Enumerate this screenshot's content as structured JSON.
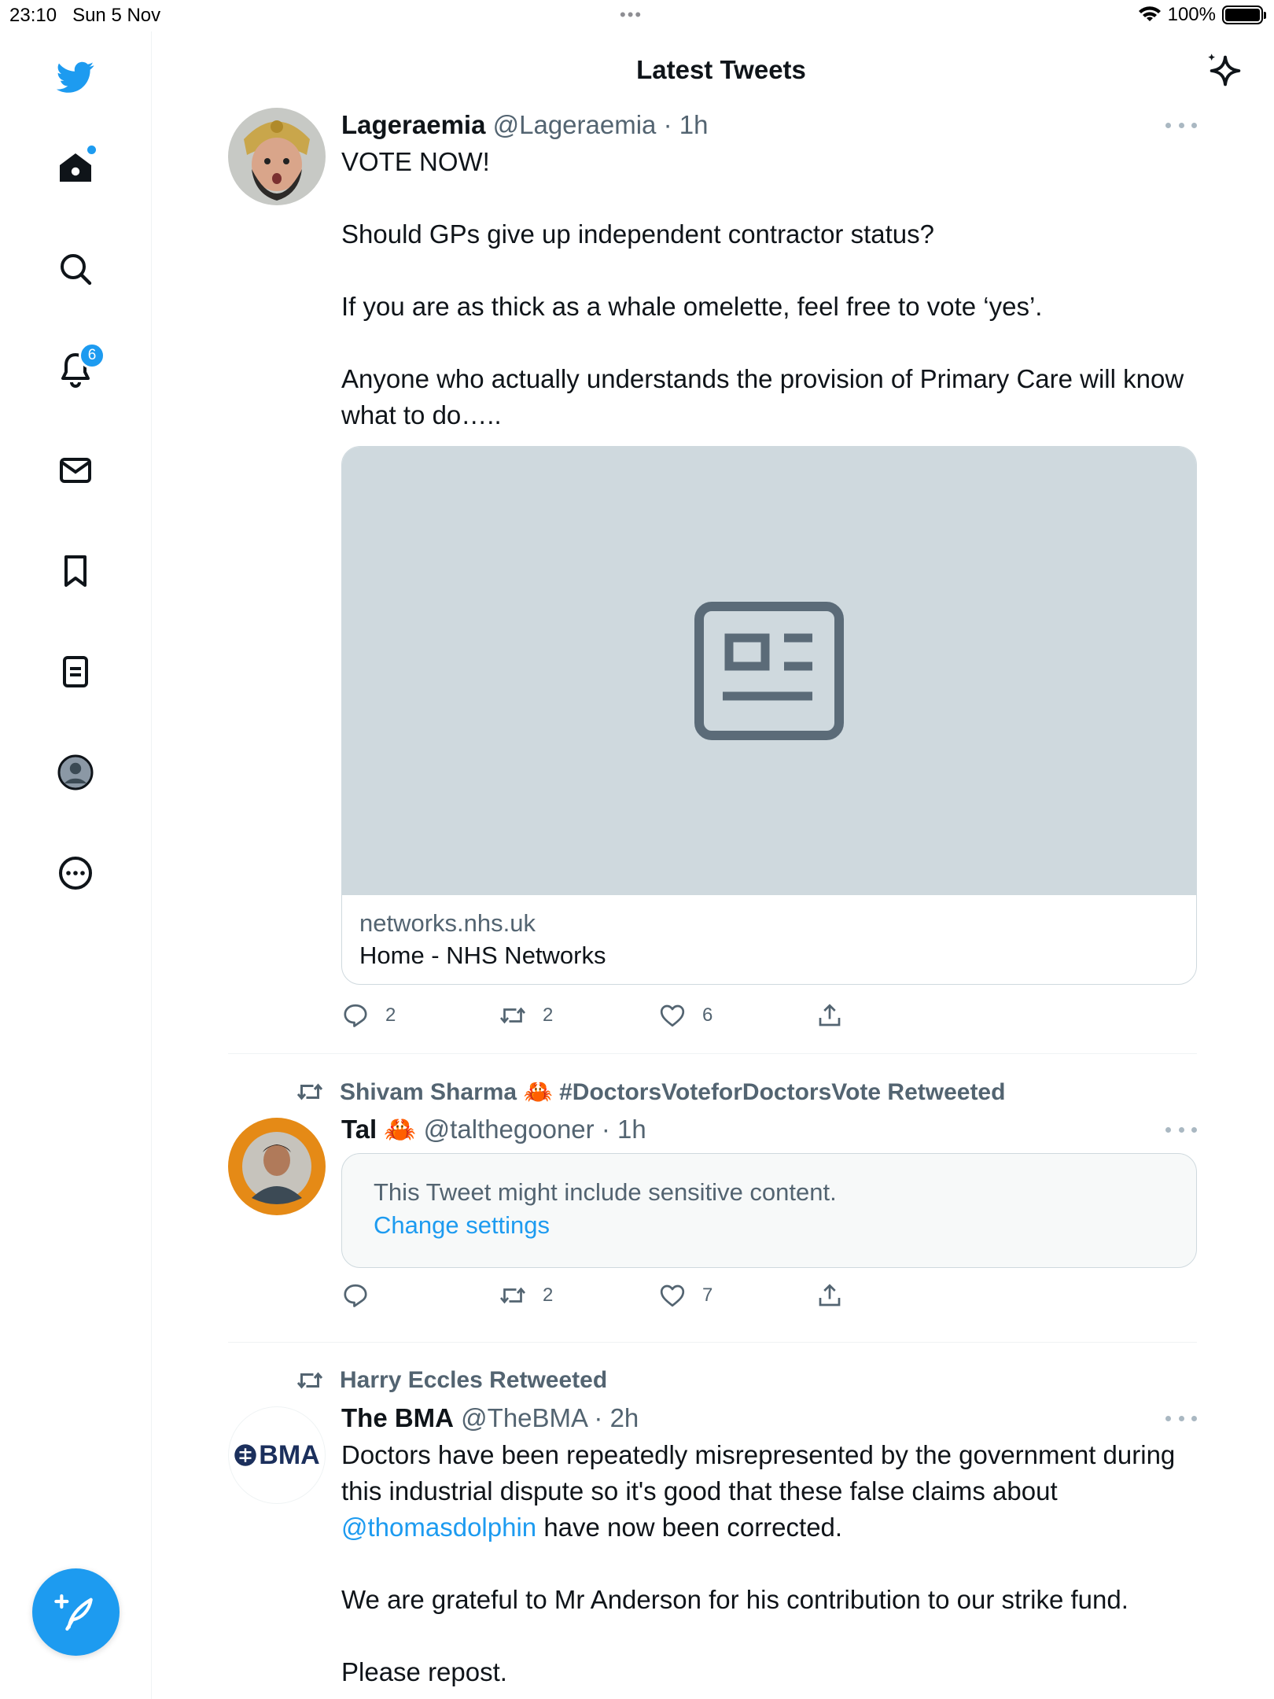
{
  "status_bar": {
    "time": "23:10",
    "date": "Sun 5 Nov",
    "battery": "100%",
    "battery_level": 1.0
  },
  "header": {
    "title": "Latest Tweets"
  },
  "sidebar": {
    "items": [
      {
        "name": "home",
        "icon": "home-icon"
      },
      {
        "name": "explore",
        "icon": "search-icon"
      },
      {
        "name": "notifications",
        "icon": "bell-icon",
        "badge": "6"
      },
      {
        "name": "messages",
        "icon": "mail-icon"
      },
      {
        "name": "bookmarks",
        "icon": "bookmark-icon"
      },
      {
        "name": "lists",
        "icon": "list-icon"
      },
      {
        "name": "profile",
        "icon": "avatar-icon"
      },
      {
        "name": "more",
        "icon": "more-circle-icon"
      }
    ]
  },
  "tweets": [
    {
      "name": "Lageraemia",
      "handle": "@Lageraemia",
      "time": "· 1h",
      "paragraphs": [
        "VOTE NOW!",
        "Should GPs give up independent contractor status?",
        "If you are as thick as a whale omelette, feel free to vote ‘yes’.",
        "Anyone who actually understands the provision of Primary Care will know what to do…..",
        ""
      ],
      "card": {
        "domain": "networks.nhs.uk",
        "title": "Home - NHS Networks"
      },
      "replies": "2",
      "retweets": "2",
      "likes": "6"
    },
    {
      "retweeted_by": "Shivam Sharma 🦀 #DoctorsVoteforDoctorsVote Retweeted",
      "name": "Tal 🦀",
      "handle": "@talthegooner",
      "time": "· 1h",
      "sensitive_text": "This Tweet might include sensitive content.",
      "sensitive_link": "Change settings",
      "replies": "",
      "retweets": "2",
      "likes": "7"
    },
    {
      "retweeted_by": "Harry Eccles Retweeted",
      "name": "The BMA",
      "handle": "@TheBMA",
      "time": "· 2h",
      "avatar_text": "BMA",
      "text_part1": "Doctors have been repeatedly misrepresented by the government during this industrial dispute so it's good that these false claims about ",
      "mention": "@thomasdolphin",
      "text_part2": " have now been corrected.",
      "paragraph2": "We are grateful to Mr Anderson for his contribution to our strike fund.",
      "paragraph3": "Please repost."
    }
  ],
  "colors": {
    "accent": "#1d9bf0",
    "text": "#0f1419",
    "secondary": "#536471",
    "border": "#cfd9de"
  }
}
